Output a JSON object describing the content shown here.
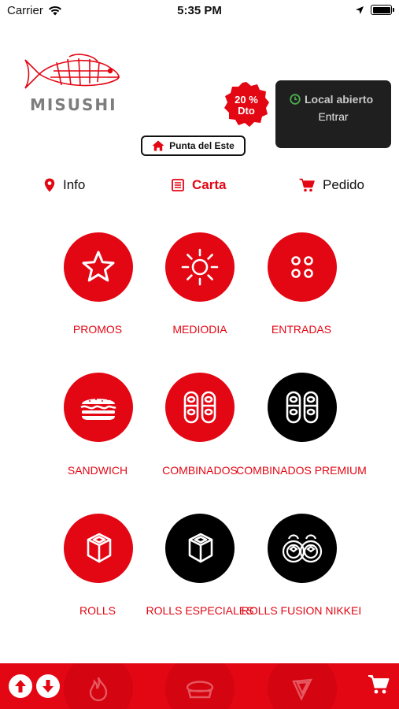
{
  "status_bar": {
    "carrier": "Carrier",
    "time": "5:35 PM"
  },
  "header": {
    "logo_text": "MISUSHI",
    "discount_badge": {
      "line1": "20 %",
      "line2": "Dto"
    },
    "open_status": "Local abierto",
    "enter_label": "Entrar",
    "location": "Punta del Este"
  },
  "tabs": [
    {
      "label": "Info",
      "icon": "map-pin-icon"
    },
    {
      "label": "Carta",
      "icon": "menu-list-icon",
      "active": true
    },
    {
      "label": "Pedido",
      "icon": "cart-icon"
    }
  ],
  "categories": [
    {
      "label": "PROMOS",
      "icon": "star-icon",
      "color": "red"
    },
    {
      "label": "MEDIODIA",
      "icon": "sun-icon",
      "color": "red"
    },
    {
      "label": "ENTRADAS",
      "icon": "four-dots-icon",
      "color": "red"
    },
    {
      "label": "SANDWICH",
      "icon": "sandwich-icon",
      "color": "red"
    },
    {
      "label": "COMBINADOS",
      "icon": "sushi-pieces-icon",
      "color": "red"
    },
    {
      "label": "COMBINADOS PREMIUM",
      "icon": "sushi-pieces-icon",
      "color": "black"
    },
    {
      "label": "ROLLS",
      "icon": "roll-icon",
      "color": "red"
    },
    {
      "label": "ROLLS ESPECIALES",
      "icon": "roll-icon",
      "color": "black"
    },
    {
      "label": "ROLLS FUSION NIKKEI",
      "icon": "nikkei-rolls-icon",
      "color": "black"
    }
  ],
  "colors": {
    "brand_red": "#e30613",
    "dark_card": "#1f1f1f",
    "open_green": "#4caf50"
  }
}
